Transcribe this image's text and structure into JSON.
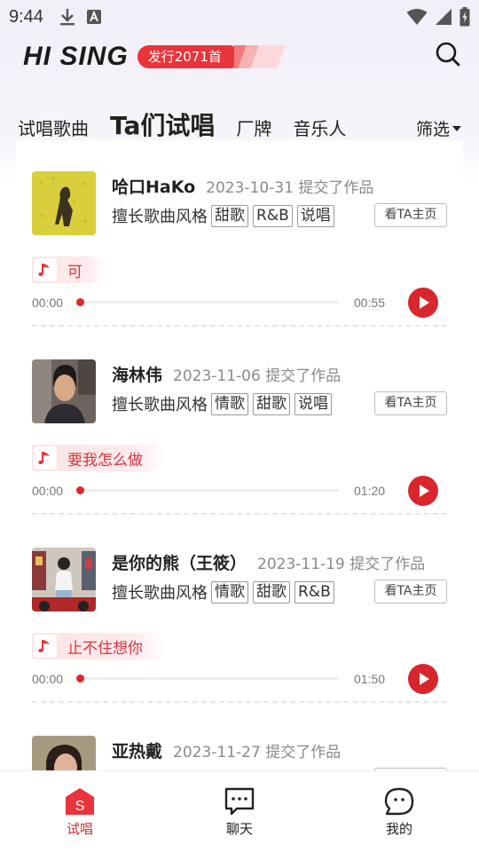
{
  "status_bar": {
    "time": "9:44"
  },
  "header": {
    "logo": "HI SING",
    "release_badge": "发行2071首",
    "colors": {
      "accent": "#e8343a",
      "accent_dark": "#d42a2f"
    }
  },
  "tabs": [
    {
      "label": "试唱歌曲",
      "active": false
    },
    {
      "label": "Ta们试唱",
      "active": true
    },
    {
      "label": "厂牌",
      "active": false
    },
    {
      "label": "音乐人",
      "active": false
    }
  ],
  "filter_label": "筛选",
  "styles_label": "擅长歌曲风格",
  "home_button_label": "看TA主页",
  "entries": [
    {
      "name": "哈口HaKo",
      "date_text": "2023-10-31 提交了作品",
      "tags": [
        "甜歌",
        "R&B",
        "说唱"
      ],
      "song": "可",
      "time_start": "00:00",
      "time_end": "00:55",
      "progress": 0.0
    },
    {
      "name": "海林伟",
      "date_text": "2023-11-06 提交了作品",
      "tags": [
        "情歌",
        "甜歌",
        "说唱"
      ],
      "song": "要我怎么做",
      "time_start": "00:00",
      "time_end": "01:20",
      "progress": 0.0
    },
    {
      "name": "是你的熊（王筱）",
      "date_text": "2023-11-19 提交了作品",
      "tags": [
        "情歌",
        "甜歌",
        "R&B"
      ],
      "song": "止不住想你",
      "time_start": "00:00",
      "time_end": "01:50",
      "progress": 0.0
    },
    {
      "name": "亚热戴",
      "date_text": "2023-11-27 提交了作品",
      "tags": [],
      "song": "",
      "time_start": "",
      "time_end": "",
      "progress": 0.0
    }
  ],
  "bottom_nav": [
    {
      "label": "试唱",
      "icon": "sing-s-icon",
      "active": true
    },
    {
      "label": "聊天",
      "icon": "chat-bubble-icon",
      "active": false
    },
    {
      "label": "我的",
      "icon": "profile-bubble-icon",
      "active": false
    }
  ]
}
